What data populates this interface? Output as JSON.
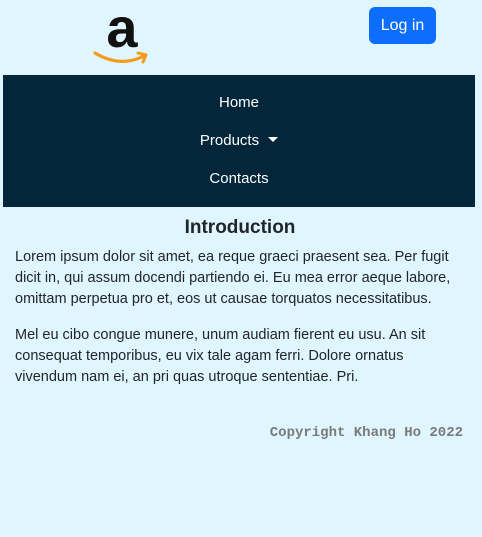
{
  "header": {
    "logo_letter": "a",
    "logo_icon": "amazon-logo-icon",
    "login_label": "Log in"
  },
  "nav": {
    "home": "Home",
    "products": "Products",
    "contacts": "Contacts"
  },
  "main": {
    "title": "Introduction",
    "paragraphs": [
      "Lorem ipsum dolor sit amet, ea reque graeci praesent sea. Per fugit dicit in, qui assum docendi partiendo ei. Eu mea error aeque labore, omittam perpetua pro et, eos ut causae torquatos necessitatibus.",
      "Mel eu cibo congue munere, unum audiam fierent eu usu. An sit consequat temporibus, eu vix tale agam ferri. Dolore ornatus vivendum nam ei, an pri quas utroque sententiae. Pri."
    ]
  },
  "footer": {
    "copyright": "Copyright Khang Ho 2022"
  },
  "colors": {
    "background": "#e0f6fe",
    "navbar": "#03263b",
    "button": "#0d6efd",
    "logo_smile": "#f59b1c"
  }
}
